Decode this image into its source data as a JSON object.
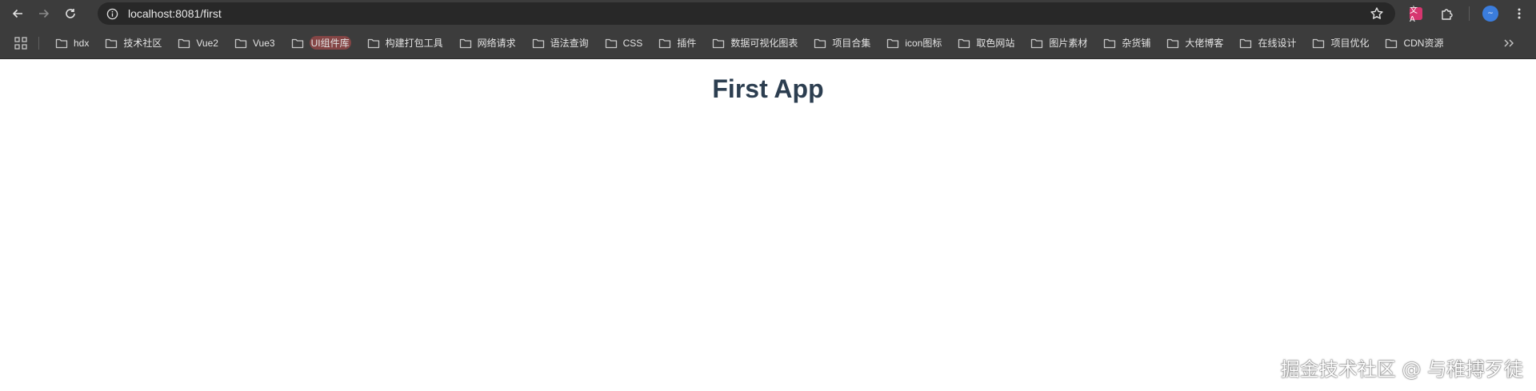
{
  "browser": {
    "url": "localhost:8081/first",
    "extension_label": "文A",
    "avatar_label": "~"
  },
  "bookmarks": [
    {
      "label": "hdx"
    },
    {
      "label": "技术社区"
    },
    {
      "label": "Vue2"
    },
    {
      "label": "Vue3"
    },
    {
      "label": "UI组件库"
    },
    {
      "label": "构建打包工具"
    },
    {
      "label": "网络请求"
    },
    {
      "label": "语法查询"
    },
    {
      "label": "CSS"
    },
    {
      "label": "插件"
    },
    {
      "label": "数据可视化图表"
    },
    {
      "label": "项目合集"
    },
    {
      "label": "icon图标"
    },
    {
      "label": "取色网站"
    },
    {
      "label": "图片素材"
    },
    {
      "label": "杂货铺"
    },
    {
      "label": "大佬博客"
    },
    {
      "label": "在线设计"
    },
    {
      "label": "项目优化"
    },
    {
      "label": "CDN资源"
    }
  ],
  "page": {
    "title": "First App",
    "title_color": "#2c3e50",
    "watermark": "掘金技术社区 @ 与稚搏歹徒"
  },
  "icons": {
    "back": "arrow-left-icon",
    "forward": "arrow-right-icon",
    "reload": "reload-icon",
    "site_info": "site-info-icon",
    "bookmark_star": "star-icon",
    "extensions": "puzzle-icon",
    "menu": "kebab-menu-icon",
    "apps": "apps-grid-icon",
    "folder": "folder-icon",
    "overflow": "double-chevron-icon"
  }
}
